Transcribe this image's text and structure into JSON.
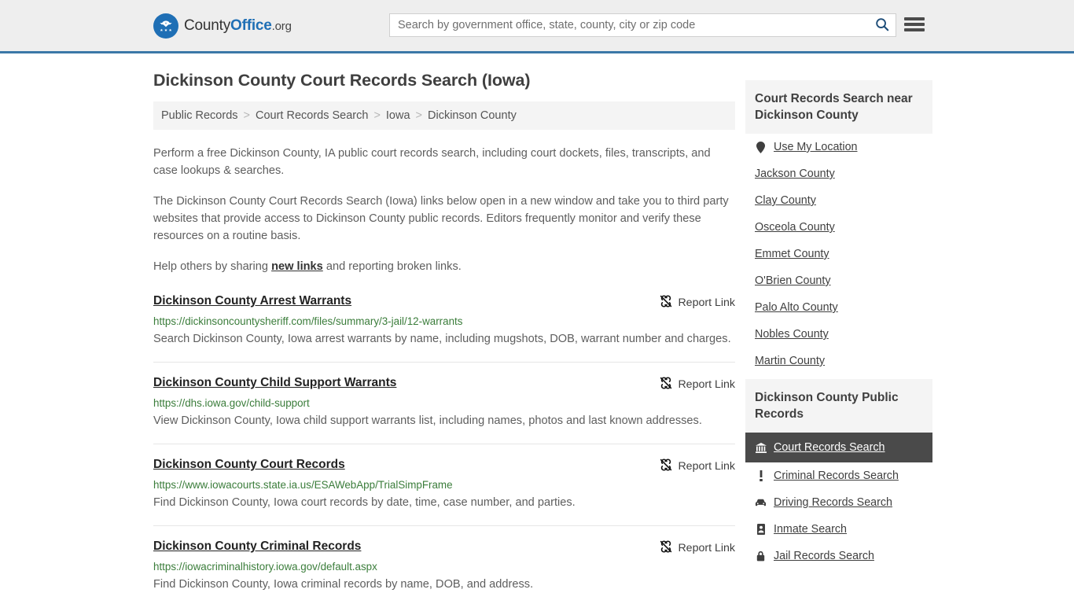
{
  "header": {
    "brand": {
      "part1": "County",
      "part2": "Office",
      "part3": ".org"
    },
    "search": {
      "placeholder": "Search by government office, state, county, city or zip code",
      "value": ""
    },
    "menu_label": "Menu",
    "accent_color": "#3b78a7",
    "brand_color": "#1f6fb5"
  },
  "page": {
    "title": "Dickinson County Court Records Search (Iowa)"
  },
  "breadcrumb": {
    "separator": ">",
    "items": [
      {
        "label": "Public Records"
      },
      {
        "label": "Court Records Search"
      },
      {
        "label": "Iowa"
      },
      {
        "label": "Dickinson County"
      }
    ]
  },
  "intro": {
    "p1": "Perform a free Dickinson County, IA public court records search, including court dockets, files, transcripts, and case lookups & searches.",
    "p2": "The Dickinson County Court Records Search (Iowa) links below open in a new window and take you to third party websites that provide access to Dickinson County public records. Editors frequently monitor and verify these resources on a routine basis.",
    "p3_before": "Help others by sharing ",
    "p3_link": "new links",
    "p3_after": " and reporting broken links."
  },
  "results": {
    "report_label": "Report Link",
    "report_icon": "broken-link-icon",
    "items": [
      {
        "title": "Dickinson County Arrest Warrants",
        "url": "https://dickinsoncountysheriff.com/files/summary/3-jail/12-warrants",
        "description": "Search Dickinson County, Iowa arrest warrants by name, including mugshots, DOB, warrant number and charges."
      },
      {
        "title": "Dickinson County Child Support Warrants",
        "url": "https://dhs.iowa.gov/child-support",
        "description": "View Dickinson County, Iowa child support warrants list, including names, photos and last known addresses."
      },
      {
        "title": "Dickinson County Court Records",
        "url": "https://www.iowacourts.state.ia.us/ESAWebApp/TrialSimpFrame",
        "description": "Find Dickinson County, Iowa court records by date, time, case number, and parties."
      },
      {
        "title": "Dickinson County Criminal Records",
        "url": "https://iowacriminalhistory.iowa.gov/default.aspx",
        "description": "Find Dickinson County, Iowa criminal records by name, DOB, and address."
      }
    ]
  },
  "sidebar": {
    "nearby": {
      "heading": "Court Records Search near Dickinson County",
      "items": [
        {
          "label": "Use My Location",
          "icon": "map-pin-icon"
        },
        {
          "label": "Jackson County",
          "icon": ""
        },
        {
          "label": "Clay County",
          "icon": ""
        },
        {
          "label": "Osceola County",
          "icon": ""
        },
        {
          "label": "Emmet County",
          "icon": ""
        },
        {
          "label": "O'Brien County",
          "icon": ""
        },
        {
          "label": "Palo Alto County",
          "icon": ""
        },
        {
          "label": "Nobles County",
          "icon": ""
        },
        {
          "label": "Martin County",
          "icon": ""
        }
      ]
    },
    "public_records": {
      "heading": "Dickinson County Public Records",
      "items": [
        {
          "label": "Court Records Search",
          "icon": "courthouse-icon",
          "active": true
        },
        {
          "label": "Criminal Records Search",
          "icon": "exclamation-icon",
          "active": false
        },
        {
          "label": "Driving Records Search",
          "icon": "car-icon",
          "active": false
        },
        {
          "label": "Inmate Search",
          "icon": "id-card-icon",
          "active": false
        },
        {
          "label": "Jail Records Search",
          "icon": "lock-icon",
          "active": false
        }
      ]
    }
  }
}
